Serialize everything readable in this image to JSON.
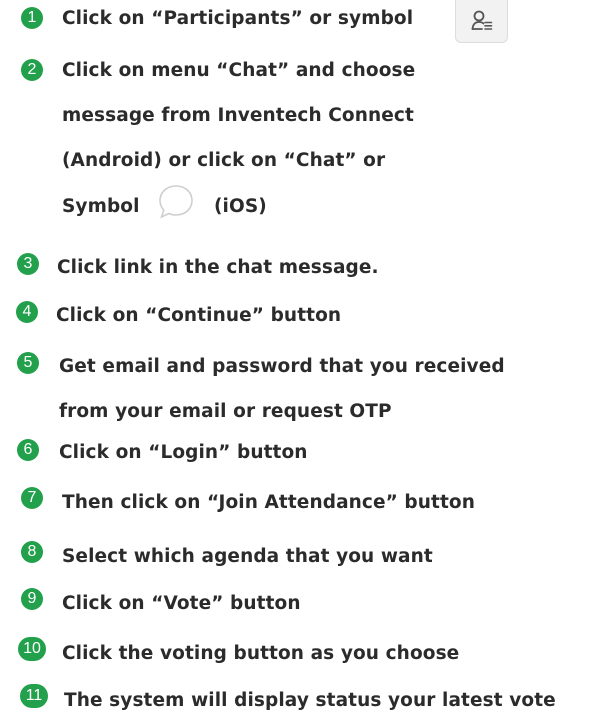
{
  "steps": [
    {
      "num": "1",
      "lines": [
        "Click on “Participants” or symbol"
      ]
    },
    {
      "num": "2",
      "lines": [
        "Click on menu “Chat” and choose",
        "message from Inventech Connect",
        "(Android) or click on “Chat” or",
        "Symbol",
        "(iOS)"
      ]
    },
    {
      "num": "3",
      "lines": [
        "Click link in the chat message."
      ]
    },
    {
      "num": "4",
      "lines": [
        "Click on “Continue” button"
      ]
    },
    {
      "num": "5",
      "lines": [
        "Get email and password that you received",
        "from your email or request OTP"
      ]
    },
    {
      "num": "6",
      "lines": [
        "Click on “Login” button"
      ]
    },
    {
      "num": "7",
      "lines": [
        "Then click on “Join Attendance” button"
      ]
    },
    {
      "num": "8",
      "lines": [
        "Select which agenda that you want"
      ]
    },
    {
      "num": "9",
      "lines": [
        "Click on “Vote” button"
      ]
    },
    {
      "num": "10",
      "lines": [
        "Click the voting button as you choose"
      ]
    },
    {
      "num": "11",
      "lines": [
        "The system will display status your latest vote"
      ]
    }
  ],
  "icons": {
    "participants": "participants-icon",
    "chat": "chat-bubble-icon"
  },
  "colors": {
    "badge": "#22a04b",
    "text": "#2b2b2b"
  }
}
